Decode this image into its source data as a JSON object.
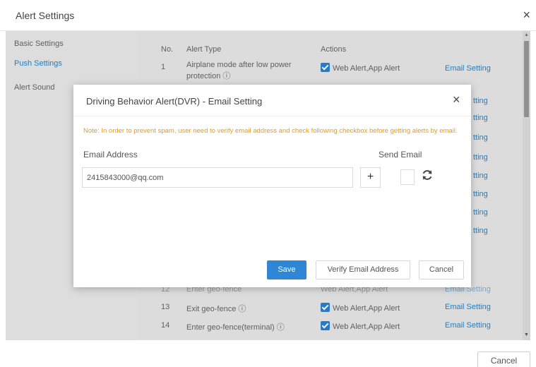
{
  "window": {
    "title": "Alert Settings",
    "close_symbol": "×"
  },
  "sidebar": {
    "items": [
      {
        "label": "Basic Settings",
        "active": false
      },
      {
        "label": "Push Settings",
        "active": true
      },
      {
        "label": "Alert Sound",
        "active": false
      }
    ]
  },
  "table": {
    "headers": {
      "no": "No.",
      "type": "Alert Type",
      "actions": "Actions"
    },
    "visible_rows": [
      {
        "no": "1",
        "type": "Airplane mode after low power",
        "type2": "protection",
        "actions": "Web Alert,App Alert",
        "link": "Email Setting"
      },
      {
        "no": "13",
        "type": "Exit geo-fence",
        "actions": "Web Alert,App Alert",
        "link": "Email Setting"
      },
      {
        "no": "14",
        "type": "Enter geo-fence(terminal)",
        "actions": "Web Alert,App Alert",
        "link": "Email Setting"
      }
    ],
    "partial_row_12": {
      "no": "12",
      "type": "Enter geo-fence",
      "actions": "Web Alert,App Alert",
      "link": "Email Setting"
    },
    "peek_link": "tting"
  },
  "footer": {
    "cancel_label": "Cancel"
  },
  "modal": {
    "title": "Driving Behavior Alert(DVR)   - Email Setting",
    "close_symbol": "×",
    "note": "Note: In order to prevent spam, user need to verify email address and check following checkbox before getting alerts by email.",
    "email_label": "Email Address",
    "send_label": "Send Email",
    "email_value": "2415843000@qq.com",
    "plus_symbol": "+",
    "save_label": "Save",
    "verify_label": "Verify Email Address",
    "cancel_label": "Cancel"
  },
  "colors": {
    "accent": "#2f86d4",
    "note": "#e89a18",
    "link": "#1e88d6"
  }
}
